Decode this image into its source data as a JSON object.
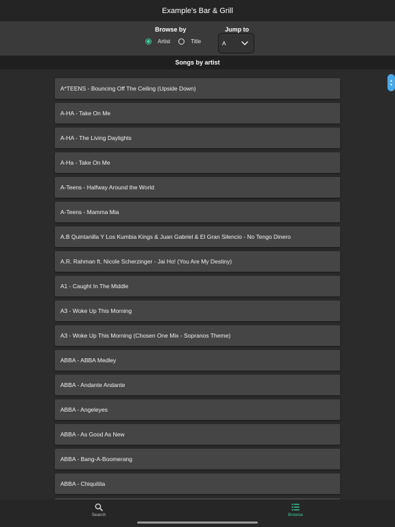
{
  "app": {
    "title": "Example's Bar & Grill"
  },
  "controls": {
    "browse_by_label": "Browse by",
    "options": [
      {
        "label": "Artist",
        "checked": true
      },
      {
        "label": "Title",
        "checked": false
      }
    ],
    "jump_to_label": "Jump to",
    "jump_to_value": "A"
  },
  "list_header": "Songs by artist",
  "songs": [
    "A*TEENS - Bouncing Off The Ceiling (Upside Down)",
    "A-HA - Take On Me",
    "A-HA - The Living Daylights",
    "A-Ha - Take On Me",
    "A-Teens - Halfway Around the World",
    "A-Teens - Mamma Mia",
    "A.B Quintanilla Y Los Kumbia Kings & Juan Gabriel & El Gran Silencio - No Tengo Dinero",
    "A.R. Rahman ft. Nicole Scherzinger - Jai Ho! (You Are My Destiny)",
    "A1 - Caught In The Middle",
    "A3 - Woke Up This Morning",
    "A3 - Woke Up This Morning (Chosen One Mix - Sopranos Theme)",
    "ABBA - ABBA Medley",
    "ABBA - Andante Andante",
    "ABBA - Angeleyes",
    "ABBA - As Good As New",
    "ABBA - Bang-A-Boomerang",
    "ABBA - Chiquitita",
    ""
  ],
  "tabs": {
    "search": {
      "label": "Search",
      "icon": "search-icon"
    },
    "browse": {
      "label": "Browse",
      "icon": "list-icon",
      "active": true
    }
  },
  "colors": {
    "accent": "#3ecf9a",
    "handle": "#4aa8e8",
    "background": "#2b2b2b",
    "row": "#454545"
  }
}
